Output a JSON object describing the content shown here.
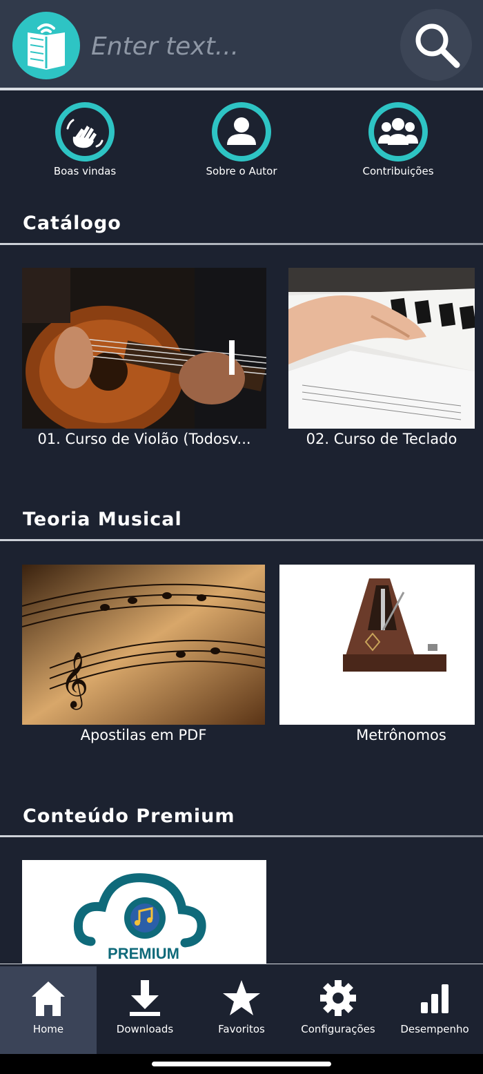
{
  "header": {
    "search_placeholder": "Enter text...",
    "logo_icon": "open-book-wifi-icon",
    "search_icon": "search-icon"
  },
  "quick_actions": [
    {
      "label": "Boas vindas",
      "icon": "waving-hand-icon"
    },
    {
      "label": "Sobre o Autor",
      "icon": "user-icon"
    },
    {
      "label": "Contribuições",
      "icon": "users-group-icon"
    }
  ],
  "sections": [
    {
      "title": "Catálogo",
      "cards": [
        {
          "label": "01. Curso de Violão (Todosv...",
          "image": "guitar-photo"
        },
        {
          "label": "02. Curso de Teclado",
          "image": "keyboard-photo"
        }
      ]
    },
    {
      "title": "Teoria Musical",
      "cards": [
        {
          "label": "Apostilas em PDF",
          "image": "sheet-music-photo"
        },
        {
          "label": "Metrônomos",
          "image": "metronome-photo"
        }
      ]
    },
    {
      "title": "Conteúdo Premium",
      "cards": [
        {
          "label": "PREMIUM",
          "image": "premium-cloud-logo"
        }
      ]
    }
  ],
  "bottom_nav": [
    {
      "label": "Home",
      "icon": "home-icon",
      "active": true
    },
    {
      "label": "Downloads",
      "icon": "download-icon",
      "active": false
    },
    {
      "label": "Favoritos",
      "icon": "star-icon",
      "active": false
    },
    {
      "label": "Configurações",
      "icon": "gear-icon",
      "active": false
    },
    {
      "label": "Desempenho",
      "icon": "bar-chart-icon",
      "active": false
    }
  ],
  "colors": {
    "background": "#1c2230",
    "header": "#313a4b",
    "accent": "#2ec4c4",
    "nav_active": "#3b4458"
  }
}
